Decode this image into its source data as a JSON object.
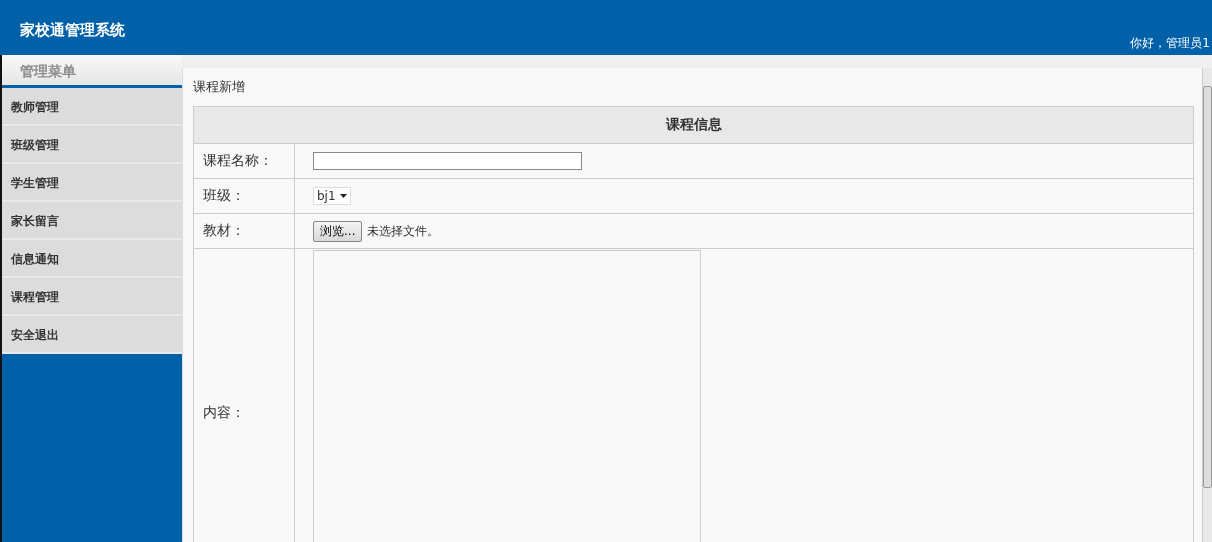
{
  "header": {
    "title": "家校通管理系统",
    "greeting": "你好，管理员1"
  },
  "sidebar": {
    "title": "管理菜单",
    "items": [
      {
        "label": "教师管理"
      },
      {
        "label": "班级管理"
      },
      {
        "label": "学生管理"
      },
      {
        "label": "家长留言"
      },
      {
        "label": "信息通知"
      },
      {
        "label": "课程管理"
      },
      {
        "label": "安全退出"
      }
    ]
  },
  "content": {
    "title": "课程新增",
    "form": {
      "heading": "课程信息",
      "rows": [
        {
          "kind": "text",
          "label": "课程名称："
        },
        {
          "kind": "select",
          "label": "班级：",
          "value": "bj1"
        },
        {
          "kind": "file",
          "label": "教材：",
          "button": "浏览...",
          "status": "未选择文件。"
        },
        {
          "kind": "textarea",
          "label": "内容："
        }
      ]
    }
  }
}
